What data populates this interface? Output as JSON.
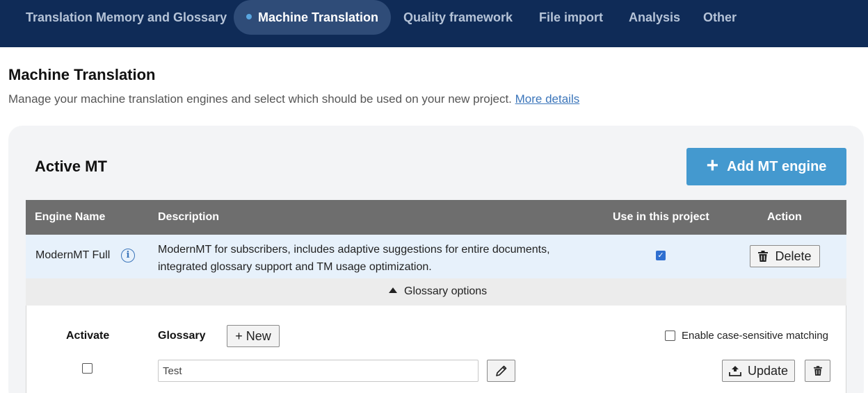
{
  "nav": {
    "tabs": [
      {
        "label": "Translation Memory and Glossary",
        "active": false
      },
      {
        "label": "Machine Translation",
        "active": true
      },
      {
        "label": "Quality framework",
        "active": false
      },
      {
        "label": "File import",
        "active": false
      },
      {
        "label": "Analysis",
        "active": false
      },
      {
        "label": "Other",
        "active": false
      }
    ]
  },
  "page": {
    "title": "Machine Translation",
    "description": "Manage your machine translation engines and select which should be used on your new project.",
    "more_link": "More details"
  },
  "active_mt": {
    "title": "Active MT",
    "add_button": "Add MT engine",
    "columns": [
      "Engine Name",
      "Description",
      "Use in this project",
      "Action"
    ],
    "rows": [
      {
        "engine_name": "ModernMT Full",
        "description": "ModernMT for subscribers, includes adaptive suggestions for entire documents, integrated glossary support and TM usage optimization.",
        "use_in_project": true,
        "action": "Delete"
      }
    ]
  },
  "glossary_options": {
    "toggle_label": "Glossary options",
    "activate_label": "Activate",
    "glossary_label": "Glossary",
    "new_button": "+ New",
    "case_sensitive_label": "Enable case-sensitive matching",
    "case_sensitive_checked": false,
    "activate_checked": false,
    "glossary_name": "Test",
    "update_button": "Update"
  },
  "colors": {
    "nav_background": "#0f2b57",
    "active_tab": "#2f4c78",
    "accent_button": "#4499cf",
    "table_header": "#6e6e6e",
    "row_highlight": "#e7f1fb",
    "link": "#3b75ba"
  }
}
